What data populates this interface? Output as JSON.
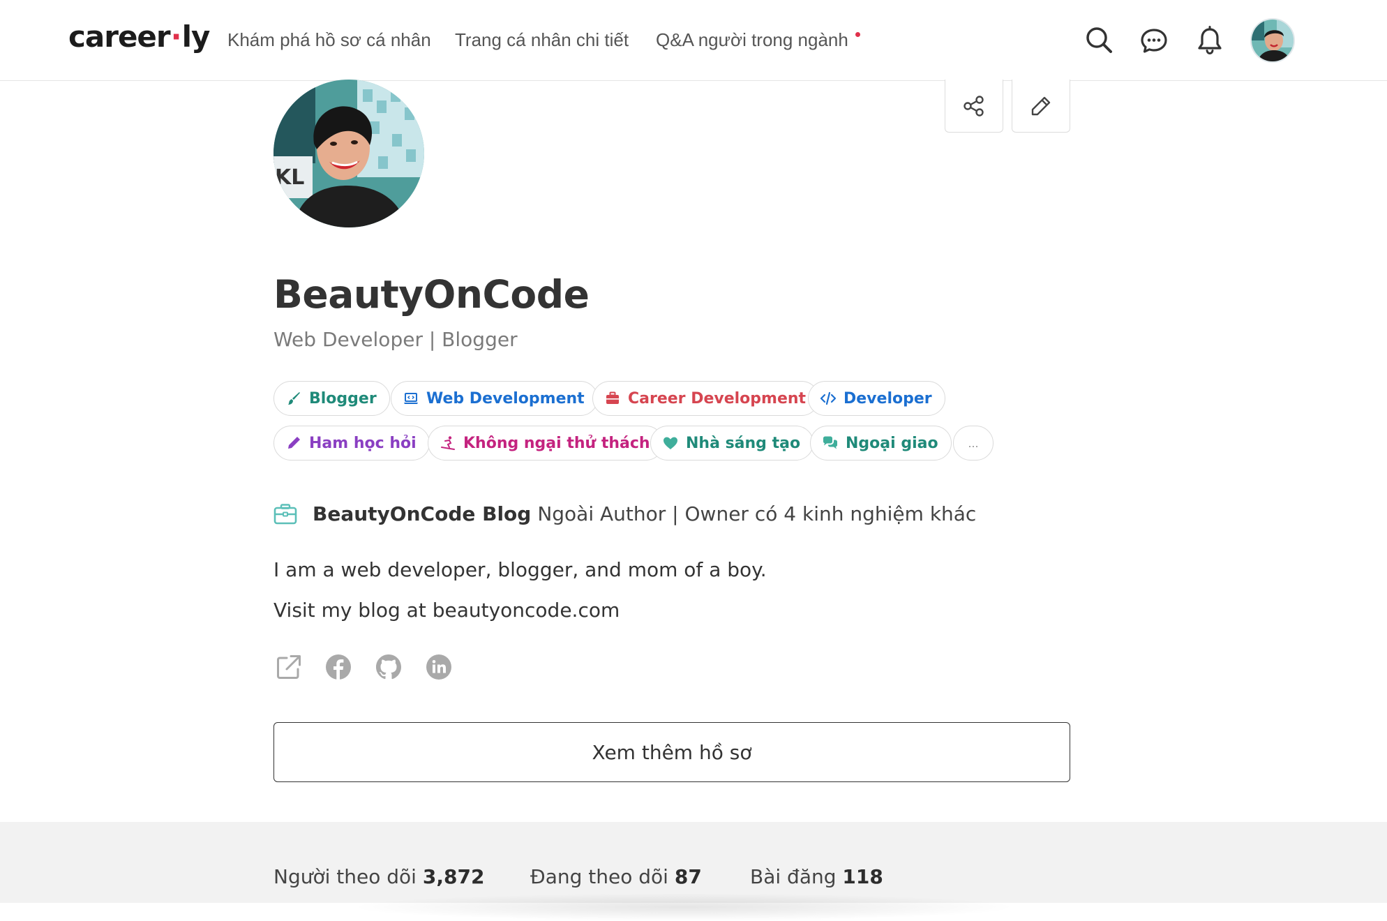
{
  "brand": {
    "logo_left": "career",
    "logo_dot": "·",
    "logo_right": "ly"
  },
  "nav": {
    "links": [
      {
        "label": "Khám phá hồ sơ cá nhân"
      },
      {
        "label": "Trang cá nhân chi tiết"
      },
      {
        "label": "Q&A người trong ngành"
      }
    ],
    "icons": [
      "search-icon",
      "messages-icon",
      "notifications-icon",
      "user-avatar"
    ]
  },
  "profile": {
    "name": "BeautyOnCode",
    "headline": "Web Developer | Blogger",
    "actions": [
      "share-icon",
      "edit-icon"
    ]
  },
  "tags": [
    {
      "label": "Blogger",
      "color": "#1f8a79",
      "icon": "brush-icon"
    },
    {
      "label": "Web Development",
      "color": "#1b6fd1",
      "icon": "laptop-code-icon"
    },
    {
      "label": "Career Development",
      "color": "#d64550",
      "icon": "briefcase-icon"
    },
    {
      "label": "Developer",
      "color": "#1b6fd1",
      "icon": "code-icon"
    },
    {
      "label": "Ham học hỏi",
      "color": "#8a3fc2",
      "icon": "pencil-icon"
    },
    {
      "label": "Không ngại thử thách",
      "color": "#c4237f",
      "icon": "snowboarder-icon"
    },
    {
      "label": "Nhà sáng tạo",
      "color": "#1f8a79",
      "icon": "heart-icon"
    },
    {
      "label": "Ngoại giao",
      "color": "#1f8a79",
      "icon": "comments-icon"
    }
  ],
  "tags_more": "...",
  "experience": {
    "company": "BeautyOnCode Blog",
    "rest": "Ngoài Author | Owner có 4 kinh nghiệm khác"
  },
  "bio": {
    "line1": "I am a web developer, blogger, and mom of a boy.",
    "line2": "Visit my blog at beautyoncode.com"
  },
  "social_links": [
    "external-link-icon",
    "facebook-icon",
    "github-icon",
    "linkedin-icon"
  ],
  "more_button": "Xem thêm hồ sơ",
  "stats": [
    {
      "label": "Người theo dõi",
      "value": "3,872"
    },
    {
      "label": "Đang theo dõi",
      "value": "87"
    },
    {
      "label": "Bài đăng",
      "value": "118"
    }
  ],
  "colors": {
    "accent_red": "#e0314b",
    "icon_gray": "#9a9a9a",
    "teal": "#5bbfb8"
  }
}
